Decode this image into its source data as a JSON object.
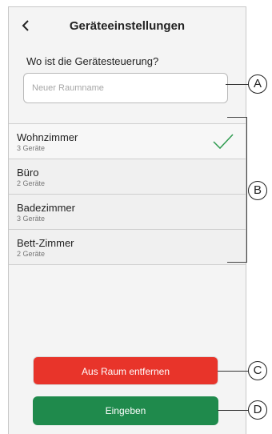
{
  "header": {
    "title": "Geräteeinstellungen",
    "back_icon": "chevron-left-icon"
  },
  "form": {
    "question": "Wo ist die Gerätesteuerung?",
    "room_name_placeholder": "Neuer Raumname",
    "room_name_value": ""
  },
  "rooms": [
    {
      "name": "Wohnzimmer",
      "count": "3 Geräte",
      "selected": true
    },
    {
      "name": "Büro",
      "count": "2 Geräte",
      "selected": false
    },
    {
      "name": "Badezimmer",
      "count": "3 Geräte",
      "selected": false
    },
    {
      "name": "Bett-Zimmer",
      "count": "2 Geräte",
      "selected": false
    }
  ],
  "buttons": {
    "remove_label": "Aus Raum entfernen",
    "enter_label": "Eingeben"
  },
  "callouts": {
    "a": "A",
    "b": "B",
    "c": "C",
    "d": "D"
  },
  "colors": {
    "remove_button": "#e8342a",
    "enter_button": "#1f8a4c",
    "check": "#2e9b4f"
  }
}
